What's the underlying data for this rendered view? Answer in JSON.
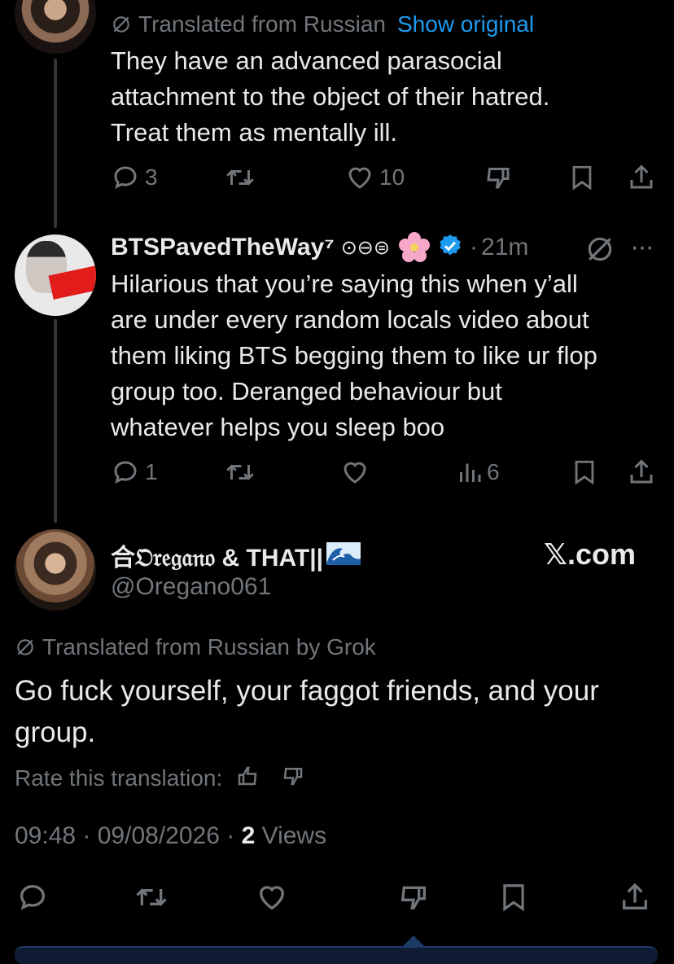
{
  "tweet1": {
    "translated_label": "Translated from Russian",
    "show_original": "Show original",
    "text_lines": [
      "They have an advanced parasocial",
      "attachment to the object of their hatred.",
      "Treat them as mentally ill."
    ],
    "replies": "3",
    "likes": "10"
  },
  "tweet2": {
    "name": "BTSPavedTheWay⁷",
    "badges": "⊙⊖⊜",
    "time": "21m",
    "text_lines": [
      "Hilarious that you’re saying this when y’all",
      "are under every random locals video about",
      "them liking BTS begging them to like ur flop",
      "group too. Deranged behaviour but",
      "whatever helps you sleep boo"
    ],
    "replies": "1",
    "views": "6"
  },
  "main": {
    "name_prefix": "合𝔒𝔯𝔢𝔤𝔞𝔫𝔬 & THAT||",
    "handle": "@Oregano061",
    "watermark": "𝕏.com",
    "translated_label": "Translated from Russian by Grok",
    "text_lines": [
      "Go fuck yourself, your faggot friends, and your",
      "group."
    ],
    "rate_label": "Rate this translation:",
    "time": "09:48",
    "date": "09/08/2026",
    "views_count": "2",
    "views_label": "Views"
  },
  "colors": {
    "accent": "#1d9bf0",
    "muted": "#71767b",
    "text": "#e7e9ea"
  }
}
